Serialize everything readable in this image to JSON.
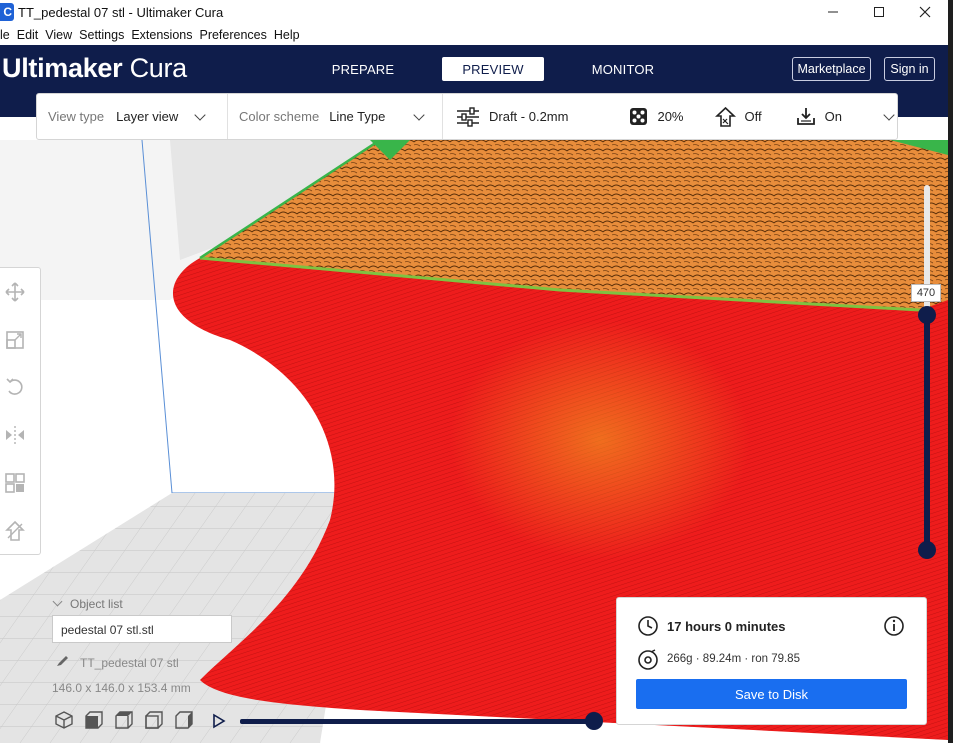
{
  "window": {
    "title": "TT_pedestal 07 stl - Ultimaker Cura",
    "app_icon_letter": "C",
    "controls": [
      "minimize",
      "maximize",
      "close"
    ]
  },
  "menu": [
    "le",
    "Edit",
    "View",
    "Settings",
    "Extensions",
    "Preferences",
    "Help"
  ],
  "header": {
    "brand_bold": "Ultimaker",
    "brand_light": "Cura",
    "stages": [
      "PREPARE",
      "PREVIEW",
      "MONITOR"
    ],
    "active_stage": "PREVIEW",
    "marketplace_label": "Marketplace",
    "signin_label": "Sign in"
  },
  "toolbar": {
    "view_type_label": "View type",
    "view_type_value": "Layer view",
    "color_scheme_label": "Color scheme",
    "color_scheme_value": "Line Type",
    "profile": "Draft - 0.2mm",
    "infill": "20%",
    "support": "Off",
    "adhesion": "On"
  },
  "layer_slider": {
    "current_layer": "470"
  },
  "object_list": {
    "title": "Object list",
    "file": "pedestal 07 stl.stl",
    "object_name": "TT_pedestal 07 stl",
    "dimensions": "146.0 x 146.0 x 153.4 mm"
  },
  "print_info": {
    "time": "17 hours 0 minutes",
    "material": "266g · 89.24m · ron 79.85",
    "save_label": "Save to Disk"
  },
  "colors": {
    "header_bg": "#0f1d4b",
    "save_button": "#196ef0",
    "wall_red": "#ee1c1c",
    "infill_orange": "#e88d3b",
    "skin_green": "#39b54a"
  },
  "icons": {
    "tools": [
      "move-icon",
      "scale-icon",
      "rotate-icon",
      "mirror-icon",
      "per-model-settings-icon",
      "support-blocker-icon"
    ],
    "camera": [
      "3d-view-icon",
      "front-view-icon",
      "top-view-icon",
      "left-view-icon",
      "right-view-icon"
    ]
  }
}
